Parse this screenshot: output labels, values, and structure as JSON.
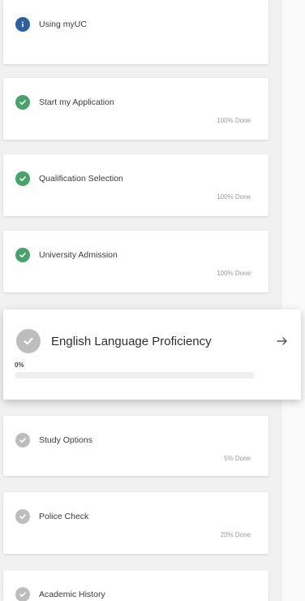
{
  "steps": [
    {
      "label": "Using myUC",
      "status": "info",
      "done": ""
    },
    {
      "label": "Start my Application",
      "status": "done",
      "done": "100% Done"
    },
    {
      "label": "Qualification Selection",
      "status": "done",
      "done": "100% Done"
    },
    {
      "label": "University Admission",
      "status": "done",
      "done": "100% Done"
    }
  ],
  "active_step": {
    "label": "English Language Proficiency",
    "status": "todo",
    "percent_label": "0%",
    "progress": 0
  },
  "later_steps": [
    {
      "label": "Study Options",
      "status": "todo",
      "done": "5% Done"
    },
    {
      "label": "Police Check",
      "status": "todo",
      "done": "20% Done"
    },
    {
      "label": "Academic History",
      "status": "todo",
      "done": ""
    }
  ],
  "colors": {
    "info": "#2d5fa3",
    "done": "#47a36b",
    "todo": "#bdbdbd",
    "background": "#f1f1f1"
  },
  "icons": {
    "info": "info-icon",
    "done": "check-icon",
    "todo": "check-icon",
    "next": "arrow-right-icon"
  }
}
